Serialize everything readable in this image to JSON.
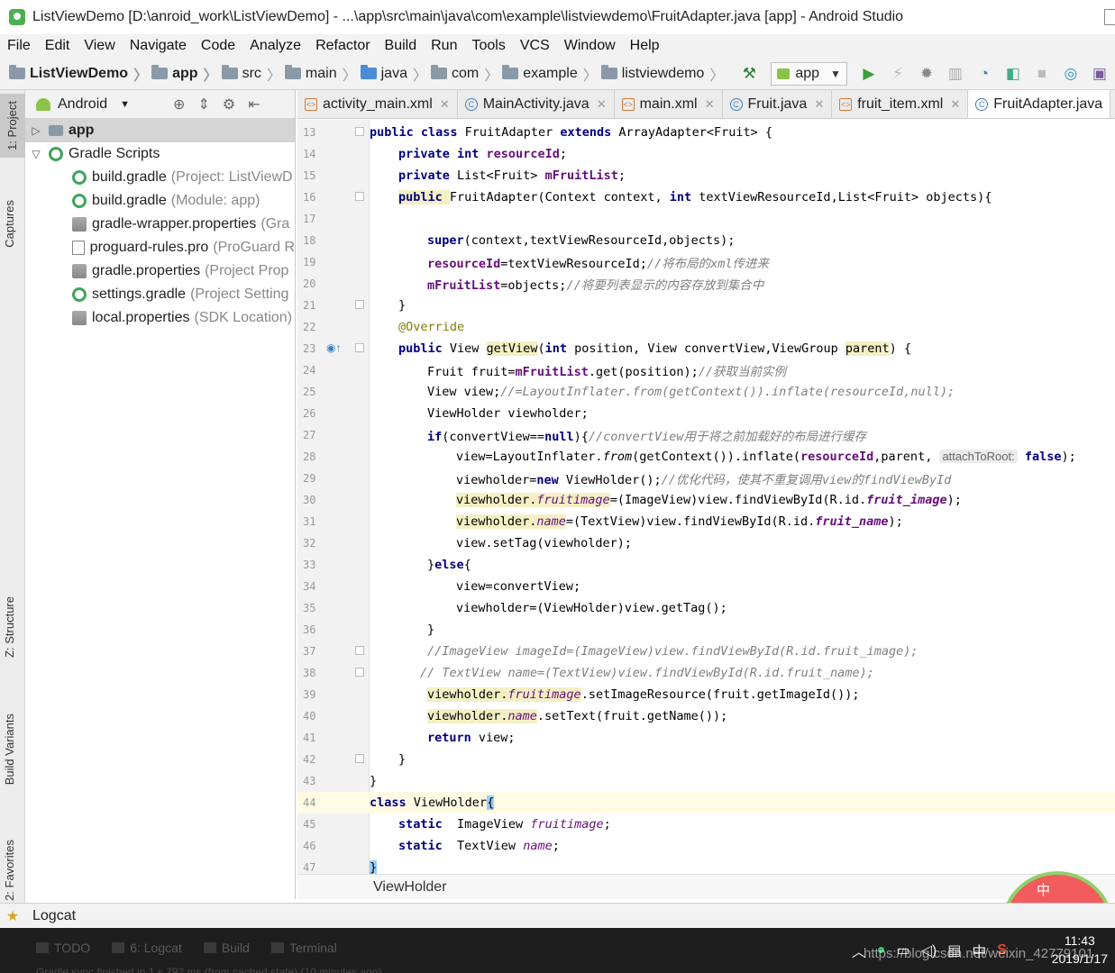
{
  "window": {
    "title": "ListViewDemo [D:\\anroid_work\\ListViewDemo] - ...\\app\\src\\main\\java\\com\\example\\listviewdemo\\FruitAdapter.java [app] - Android Studio"
  },
  "menu": [
    "File",
    "Edit",
    "View",
    "Navigate",
    "Code",
    "Analyze",
    "Refactor",
    "Build",
    "Run",
    "Tools",
    "VCS",
    "Window",
    "Help"
  ],
  "nav": {
    "crumbs": [
      "ListViewDemo",
      "app",
      "src",
      "main",
      "java",
      "com",
      "example",
      "listviewdemo"
    ],
    "run_config": "app"
  },
  "left_tabs": {
    "project": "1: Project",
    "captures": "Captures",
    "structure": "Z: Structure",
    "build_variants": "Build Variants",
    "favorites": "2: Favorites"
  },
  "project_panel": {
    "view_mode": "Android",
    "tree": [
      {
        "label": "app",
        "meta": ""
      },
      {
        "label": "Gradle Scripts",
        "meta": ""
      },
      {
        "label": "build.gradle",
        "meta": "(Project: ListViewD"
      },
      {
        "label": "build.gradle",
        "meta": "(Module: app)"
      },
      {
        "label": "gradle-wrapper.properties",
        "meta": "(Gra"
      },
      {
        "label": "proguard-rules.pro",
        "meta": "(ProGuard R"
      },
      {
        "label": "gradle.properties",
        "meta": "(Project Prop"
      },
      {
        "label": "settings.gradle",
        "meta": "(Project Setting"
      },
      {
        "label": "local.properties",
        "meta": "(SDK Location)"
      }
    ]
  },
  "editor_tabs": [
    "activity_main.xml",
    "MainActivity.java",
    "main.xml",
    "Fruit.java",
    "fruit_item.xml",
    "FruitAdapter.java"
  ],
  "code": {
    "line_numbers": [
      "13",
      "14",
      "15",
      "16",
      "17",
      "18",
      "19",
      "20",
      "21",
      "22",
      "23",
      "24",
      "25",
      "26",
      "27",
      "28",
      "29",
      "30",
      "31",
      "32",
      "33",
      "34",
      "35",
      "36",
      "37",
      "38",
      "39",
      "40",
      "41",
      "42",
      "43",
      "44",
      "45",
      "46",
      "47"
    ],
    "l13": [
      "public class ",
      "FruitAdapter ",
      "extends ",
      "ArrayAdapter<Fruit> {"
    ],
    "l14": [
      "private int ",
      "resourceId",
      ";"
    ],
    "l15": [
      "private ",
      "List<Fruit> ",
      "mFruitList",
      ";"
    ],
    "l16": [
      "public ",
      "FruitAdapter(Context context, ",
      "int ",
      "textViewResourceId,List<Fruit> objects){"
    ],
    "l18": [
      "super",
      "(context,textViewResourceId,objects);"
    ],
    "l19": [
      "resourceId",
      "=textViewResourceId;",
      "//将布局的xml传进来"
    ],
    "l20": [
      "mFruitList",
      "=objects;",
      "//将要列表显示的内容存放到集合中"
    ],
    "l21": "}",
    "l22": "@Override",
    "l23": [
      "public ",
      "View ",
      "getView",
      "(",
      "int ",
      "position, View convertView,ViewGroup ",
      "parent",
      ") {"
    ],
    "l24": [
      "Fruit fruit=",
      "mFruitList",
      ".get(position);",
      "//获取当前实例"
    ],
    "l25": [
      "View view;",
      "//=LayoutInflater.from(getContext()).inflate(resourceId,null);"
    ],
    "l26": "ViewHolder viewholder;",
    "l27": [
      "if",
      "(convertView==",
      "null",
      "){",
      "//convertView用于将之前加载好的布局进行缓存"
    ],
    "l28": [
      "view=LayoutInflater.",
      "from",
      "(getContext()).inflate(",
      "resourceId",
      ",parent, ",
      "attachToRoot:",
      " ",
      "false",
      ");"
    ],
    "l29": [
      "viewholder=",
      "new ",
      "ViewHolder();",
      "//优化代码，使其不重复调用view的findViewById"
    ],
    "l30": [
      "viewholder.",
      "fruitimage",
      "=(ImageView)view.findViewById(R.id.",
      "fruit_image",
      ");"
    ],
    "l31": [
      "viewholder.",
      "name",
      "=(TextView)view.findViewById(R.id.",
      "fruit_name",
      ");"
    ],
    "l32": "view.setTag(viewholder);",
    "l33": [
      "}",
      "else",
      "{"
    ],
    "l34": "view=convertView;",
    "l35": "viewholder=(ViewHolder)view.getTag();",
    "l36": "}",
    "l37": "//ImageView imageId=(ImageView)view.findViewById(R.id.fruit_image);",
    "l38": "// TextView name=(TextView)view.findViewById(R.id.fruit_name);",
    "l39": [
      "viewholder.",
      "fruitimage",
      ".setImageResource(fruit.getImageId());"
    ],
    "l40": [
      "viewholder.",
      "name",
      ".setText(fruit.getName());"
    ],
    "l41": [
      "return ",
      "view;"
    ],
    "l42": "}",
    "l43": "}",
    "l44": [
      "class ",
      "ViewHolder",
      "{"
    ],
    "l45": [
      "static ",
      " ImageView ",
      "fruitimage",
      ";"
    ],
    "l46": [
      "static ",
      " TextView ",
      "name",
      ";"
    ],
    "l47": "}"
  },
  "editor_breadcrumb": "ViewHolder",
  "logcat_label": "Logcat",
  "bottom_tabs": [
    "TODO",
    "6: Logcat",
    "Build",
    "Terminal"
  ],
  "status": "Gradle sync finished in 1 s 792 ms (from cached state) (10 minutes ago)",
  "tray": {
    "time": "11:43",
    "date": "2019/1/17",
    "ime": "中"
  },
  "watermark": "https://blog.csdn.net/weixin_42779101",
  "float_widget_text": "中"
}
